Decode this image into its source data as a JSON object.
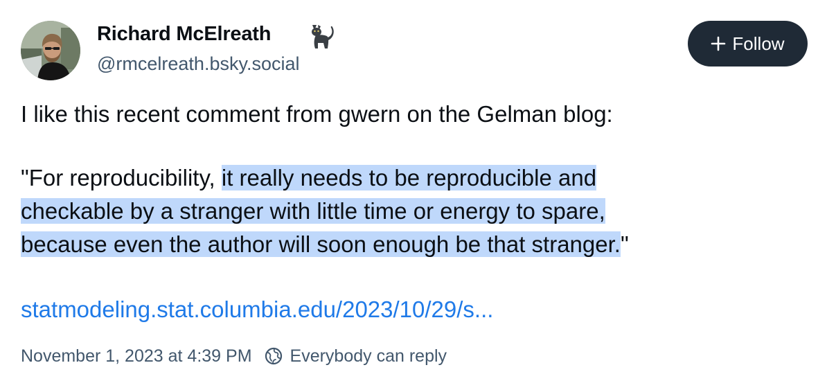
{
  "post": {
    "author": {
      "display_name": "Richard McElreath",
      "name_emoji": "cat-icon",
      "handle": "@rmcelreath.bsky.social"
    },
    "follow_button": {
      "icon": "plus-icon",
      "label": "Follow"
    },
    "text": {
      "intro": "I like this recent comment from gwern on the Gelman blog:",
      "quote_lines": [
        {
          "plain": "\"For reproducibility, ",
          "highlighted": "it really needs to be reproducible and",
          "after": ""
        },
        {
          "plain": "",
          "highlighted": "checkable by a stranger with little time or energy to spare,",
          "after": ""
        },
        {
          "plain": "",
          "highlighted": "because even the author will soon enough be that stranger.",
          "after": "\""
        }
      ]
    },
    "link_text": "statmodeling.stat.columbia.edu/2023/10/29/s...",
    "timestamp": "November 1, 2023 at 4:39 PM",
    "reply_setting": {
      "icon": "globe-icon",
      "label": "Everybody can reply"
    }
  },
  "colors": {
    "highlight": "#bfd8fb",
    "link": "#1f7ae8",
    "follow_button_bg": "#1f2a36",
    "muted_text": "#42576c"
  }
}
